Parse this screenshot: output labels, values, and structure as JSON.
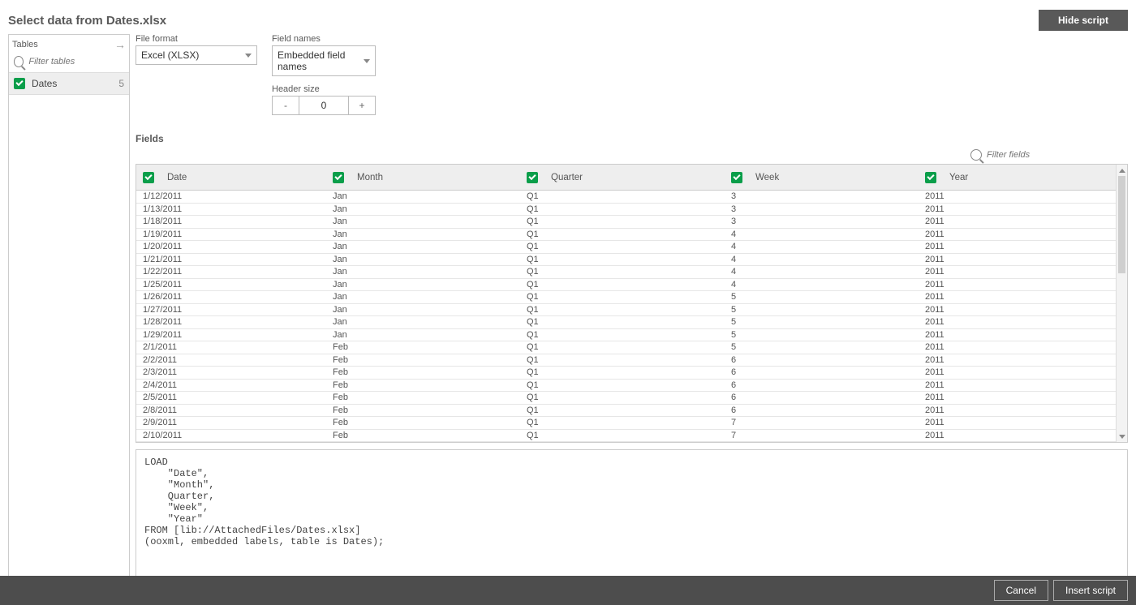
{
  "title": "Select data from Dates.xlsx",
  "hide_script": "Hide script",
  "sidebar": {
    "tables_label": "Tables",
    "filter_placeholder": "Filter tables",
    "item": {
      "name": "Dates",
      "count": "5"
    }
  },
  "settings": {
    "file_format_label": "File format",
    "file_format_value": "Excel (XLSX)",
    "field_names_label": "Field names",
    "field_names_value": "Embedded field names",
    "header_size_label": "Header size",
    "header_size_value": "0",
    "minus": "-",
    "plus": "+"
  },
  "fields_label": "Fields",
  "filter_fields_placeholder": "Filter fields",
  "columns": [
    "Date",
    "Month",
    "Quarter",
    "Week",
    "Year"
  ],
  "rows": [
    [
      "1/12/2011",
      "Jan",
      "Q1",
      "3",
      "2011"
    ],
    [
      "1/13/2011",
      "Jan",
      "Q1",
      "3",
      "2011"
    ],
    [
      "1/18/2011",
      "Jan",
      "Q1",
      "3",
      "2011"
    ],
    [
      "1/19/2011",
      "Jan",
      "Q1",
      "4",
      "2011"
    ],
    [
      "1/20/2011",
      "Jan",
      "Q1",
      "4",
      "2011"
    ],
    [
      "1/21/2011",
      "Jan",
      "Q1",
      "4",
      "2011"
    ],
    [
      "1/22/2011",
      "Jan",
      "Q1",
      "4",
      "2011"
    ],
    [
      "1/25/2011",
      "Jan",
      "Q1",
      "4",
      "2011"
    ],
    [
      "1/26/2011",
      "Jan",
      "Q1",
      "5",
      "2011"
    ],
    [
      "1/27/2011",
      "Jan",
      "Q1",
      "5",
      "2011"
    ],
    [
      "1/28/2011",
      "Jan",
      "Q1",
      "5",
      "2011"
    ],
    [
      "1/29/2011",
      "Jan",
      "Q1",
      "5",
      "2011"
    ],
    [
      "2/1/2011",
      "Feb",
      "Q1",
      "5",
      "2011"
    ],
    [
      "2/2/2011",
      "Feb",
      "Q1",
      "6",
      "2011"
    ],
    [
      "2/3/2011",
      "Feb",
      "Q1",
      "6",
      "2011"
    ],
    [
      "2/4/2011",
      "Feb",
      "Q1",
      "6",
      "2011"
    ],
    [
      "2/5/2011",
      "Feb",
      "Q1",
      "6",
      "2011"
    ],
    [
      "2/8/2011",
      "Feb",
      "Q1",
      "6",
      "2011"
    ],
    [
      "2/9/2011",
      "Feb",
      "Q1",
      "7",
      "2011"
    ],
    [
      "2/10/2011",
      "Feb",
      "Q1",
      "7",
      "2011"
    ]
  ],
  "script": "LOAD\n    \"Date\",\n    \"Month\",\n    Quarter,\n    \"Week\",\n    \"Year\"\nFROM [lib://AttachedFiles/Dates.xlsx]\n(ooxml, embedded labels, table is Dates);",
  "footer": {
    "cancel": "Cancel",
    "insert": "Insert script"
  }
}
